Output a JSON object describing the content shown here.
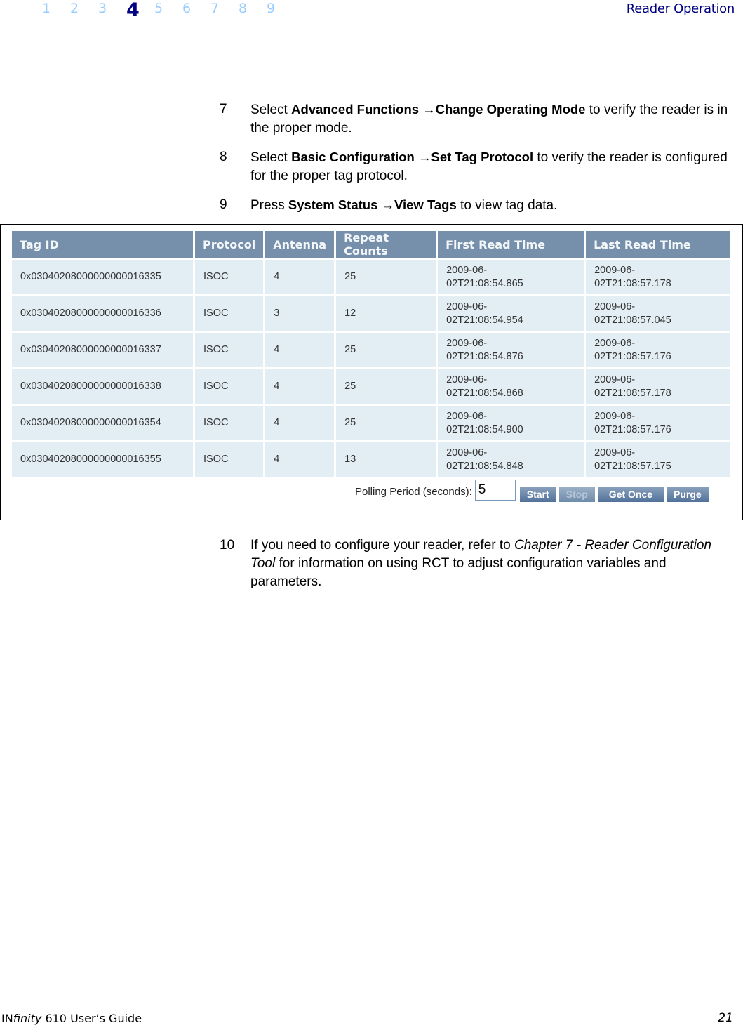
{
  "header": {
    "chapters": [
      "1",
      "2",
      "3",
      "4",
      "5",
      "6",
      "7",
      "8",
      "9"
    ],
    "current_chapter": "4",
    "section_title": "Reader Operation"
  },
  "steps": [
    {
      "number": "7",
      "parts": [
        {
          "text": "Select ",
          "style": "normal"
        },
        {
          "text": "Advanced Functions →Change Operating Mode",
          "style": "bold"
        },
        {
          "text": " to verify the reader is in the proper mode.",
          "style": "normal"
        }
      ]
    },
    {
      "number": "8",
      "parts": [
        {
          "text": "Select ",
          "style": "normal"
        },
        {
          "text": "Basic Configuration →Set Tag Protocol",
          "style": "bold"
        },
        {
          "text": " to verify the reader is configured for the proper tag protocol.",
          "style": "normal"
        }
      ]
    },
    {
      "number": "9",
      "parts": [
        {
          "text": "Press ",
          "style": "normal"
        },
        {
          "text": "System Status →View Tags",
          "style": "bold"
        },
        {
          "text": " to view tag data.",
          "style": "normal"
        }
      ]
    },
    {
      "number": "10",
      "parts": [
        {
          "text": "If you need to configure your reader, refer to ",
          "style": "normal"
        },
        {
          "text": "Chapter 7 -  Reader Configuration Tool",
          "style": "italic"
        },
        {
          "text": " for information on using RCT to adjust configuration variables and parameters.",
          "style": "normal"
        }
      ]
    }
  ],
  "tag_table": {
    "columns": [
      "Tag ID",
      "Protocol",
      "Antenna",
      "Repeat Counts",
      "First Read Time",
      "Last Read Time"
    ],
    "rows": [
      [
        "0x03040208000000000016335",
        "ISOC",
        "4",
        "25",
        "2009-06-02T21:08:54.865",
        "2009-06-02T21:08:57.178"
      ],
      [
        "0x03040208000000000016336",
        "ISOC",
        "3",
        "12",
        "2009-06-02T21:08:54.954",
        "2009-06-02T21:08:57.045"
      ],
      [
        "0x03040208000000000016337",
        "ISOC",
        "4",
        "25",
        "2009-06-02T21:08:54.876",
        "2009-06-02T21:08:57.176"
      ],
      [
        "0x03040208000000000016338",
        "ISOC",
        "4",
        "25",
        "2009-06-02T21:08:54.868",
        "2009-06-02T21:08:57.178"
      ],
      [
        "0x03040208000000000016354",
        "ISOC",
        "4",
        "25",
        "2009-06-02T21:08:54.900",
        "2009-06-02T21:08:57.176"
      ],
      [
        "0x03040208000000000016355",
        "ISOC",
        "4",
        "13",
        "2009-06-02T21:08:54.848",
        "2009-06-02T21:08:57.175"
      ]
    ]
  },
  "polling": {
    "label": "Polling Period (seconds):",
    "value": "5",
    "buttons": [
      {
        "label": "Start",
        "enabled": true
      },
      {
        "label": "Stop",
        "enabled": false
      },
      {
        "label": "Get Once",
        "enabled": true
      },
      {
        "label": "Purge",
        "enabled": true
      }
    ]
  },
  "footer": {
    "product_prefix": "IN",
    "product_italic": "finity",
    "product_suffix": " 610 User’s Guide",
    "page_number": "21"
  }
}
